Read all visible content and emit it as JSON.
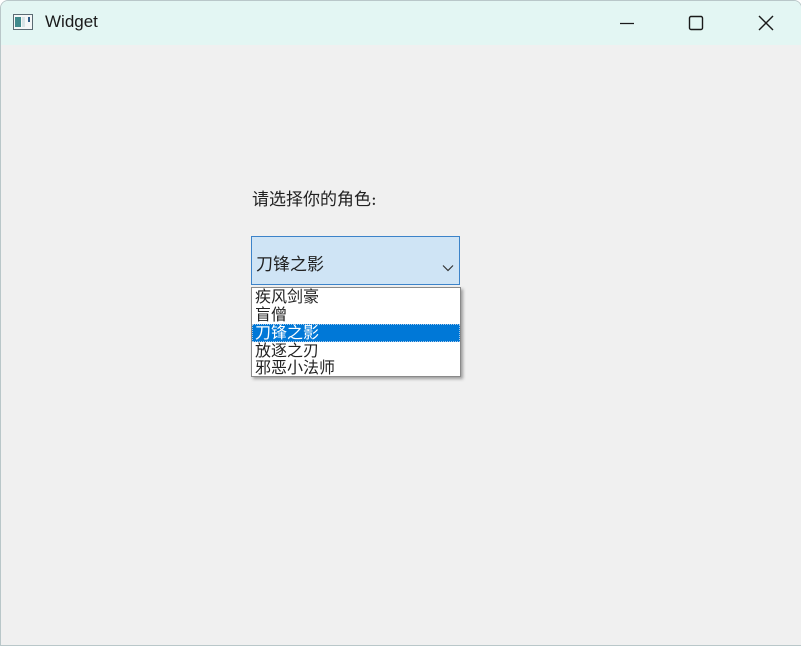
{
  "window": {
    "title": "Widget"
  },
  "form": {
    "prompt": "请选择你的角色:",
    "combo": {
      "selected": "刀锋之影",
      "options": [
        "疾风剑豪",
        "盲僧",
        "刀锋之影",
        "放逐之刃",
        "邪恶小法师"
      ],
      "selected_index": 2
    }
  },
  "colors": {
    "titlebar": "#e3f6f3",
    "background": "#f0f0f0",
    "combo_fill": "#cfe4f5",
    "combo_border": "#3c83c9",
    "selection": "#0078d7"
  },
  "icons": {
    "app": "app-window-icon",
    "minimize": "minimize-icon",
    "maximize": "maximize-icon",
    "close": "close-icon",
    "dropdown": "chevron-down-icon"
  }
}
